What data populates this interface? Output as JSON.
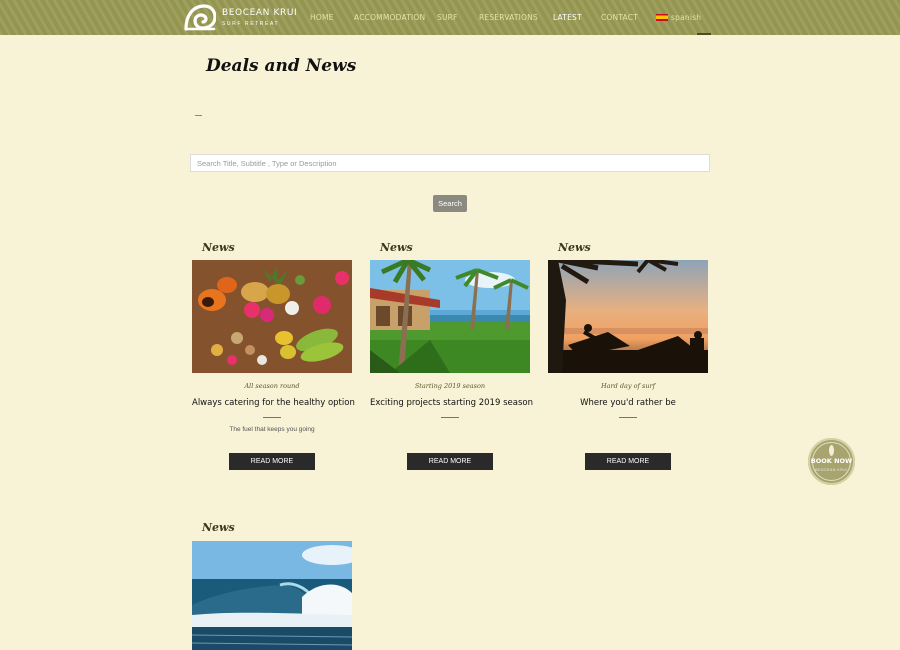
{
  "header": {
    "logo_name": "BEOCEAN KRUI",
    "logo_tagline": "SURF RETREAT",
    "nav": [
      {
        "label": "HOME"
      },
      {
        "label": "ACCOMMODATION"
      },
      {
        "label": "SURF"
      },
      {
        "label": "RESERVATIONS"
      },
      {
        "label": "LATEST"
      },
      {
        "label": "CONTACT"
      }
    ],
    "language": "spanish",
    "active_nav": "LATEST"
  },
  "page": {
    "title": "Deals and News"
  },
  "search": {
    "placeholder": "Search Title, Subtitle , Type or Description",
    "value": "",
    "button_label": "Search"
  },
  "cards": [
    {
      "type": "News",
      "subtitle": "All season round",
      "title": "Always catering for the healthy option",
      "description": "The fuel that keeps you going",
      "button": "READ MORE"
    },
    {
      "type": "News",
      "subtitle": "Starting 2019 season",
      "title": "Exciting projects starting 2019 season",
      "description": "",
      "button": "READ MORE"
    },
    {
      "type": "News",
      "subtitle": "Hard day of surf",
      "title": "Where you'd rather be",
      "description": "",
      "button": "READ MORE"
    },
    {
      "type": "News"
    }
  ],
  "book_now": {
    "label": "BOOK NOW",
    "sub": "BEOCEAN KRUI"
  },
  "colors": {
    "header_bg": "#9a9a55",
    "page_bg": "#f8f2d6",
    "button_dark": "#2a2a2a",
    "search_button": "#8a8a80"
  }
}
